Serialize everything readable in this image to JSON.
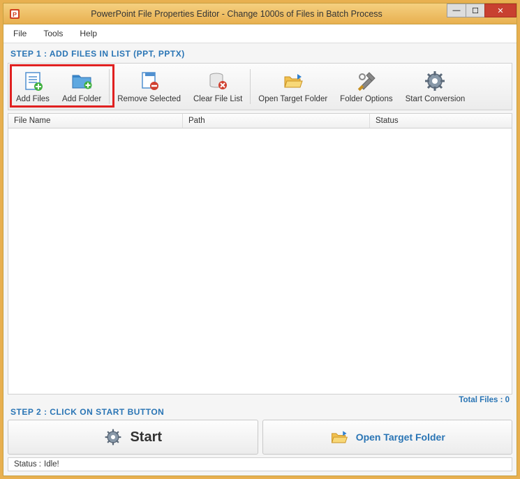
{
  "titlebar": {
    "title": "PowerPoint File Properties Editor - Change 1000s of Files in Batch Process"
  },
  "menubar": {
    "file": "File",
    "tools": "Tools",
    "help": "Help"
  },
  "step1": {
    "label": "STEP 1 : ADD FILES IN LIST (PPT, PPTX)"
  },
  "toolbar": {
    "add_files": "Add Files",
    "add_folder": "Add Folder",
    "remove_selected": "Remove Selected",
    "clear_file_list": "Clear File List",
    "open_target_folder": "Open Target Folder",
    "folder_options": "Folder Options",
    "start_conversion": "Start Conversion"
  },
  "list": {
    "col_filename": "File Name",
    "col_path": "Path",
    "col_status": "Status"
  },
  "total_files": "Total Files : 0",
  "step2": {
    "label": "STEP 2 : CLICK ON START BUTTON"
  },
  "big_buttons": {
    "start": "Start",
    "open_target_folder": "Open Target Folder"
  },
  "statusbar": {
    "label": "Status :",
    "value": "Idle!"
  }
}
